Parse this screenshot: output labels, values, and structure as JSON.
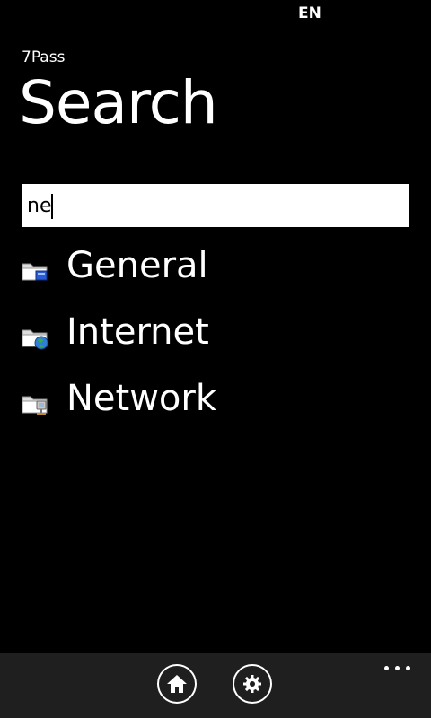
{
  "status_bar": {
    "language": "EN"
  },
  "app": {
    "name": "7Pass"
  },
  "page": {
    "title": "Search"
  },
  "search": {
    "value": "ne"
  },
  "results": [
    {
      "label": "General",
      "icon": "folder-general-icon"
    },
    {
      "label": "Internet",
      "icon": "folder-internet-icon"
    },
    {
      "label": "Network",
      "icon": "folder-network-icon"
    }
  ],
  "app_bar": {
    "buttons": [
      {
        "icon": "home-icon"
      },
      {
        "icon": "settings-gear-icon"
      }
    ],
    "more_icon": "more-ellipsis-icon"
  },
  "colors": {
    "background": "#000000",
    "app_bar": "#1f1f1f",
    "text": "#ffffff",
    "search_box": "#ffffff"
  }
}
